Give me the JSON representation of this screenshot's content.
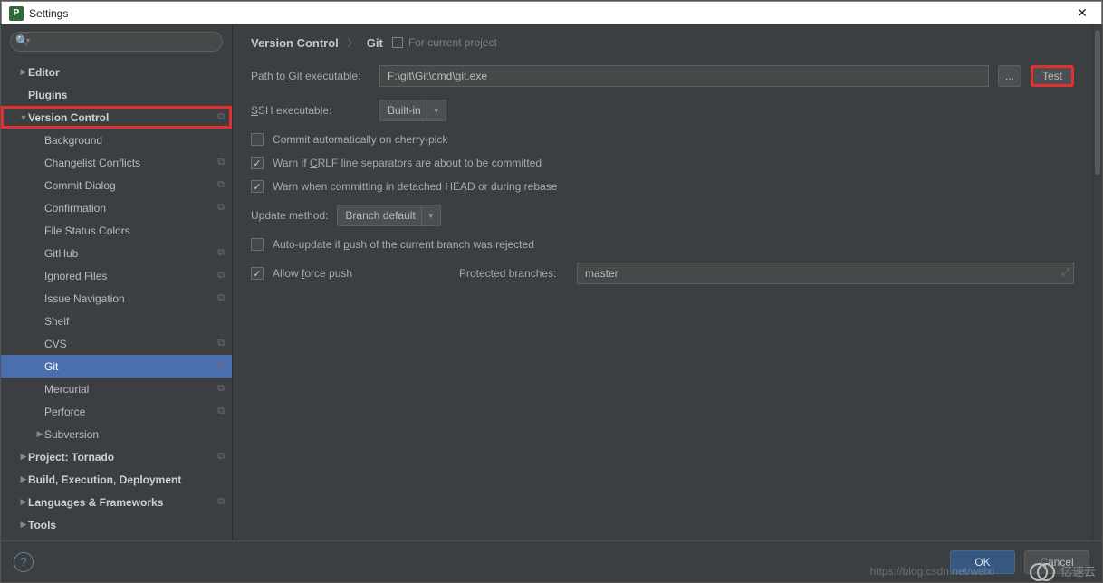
{
  "window": {
    "title": "Settings"
  },
  "search": {
    "placeholder": ""
  },
  "sidebar": {
    "items": [
      {
        "label": "Editor",
        "indent": 0,
        "bold": true,
        "arrow": "▶",
        "micon": false
      },
      {
        "label": "Plugins",
        "indent": 0,
        "bold": true,
        "arrow": "",
        "micon": false
      },
      {
        "label": "Version Control",
        "indent": 0,
        "bold": true,
        "arrow": "▼",
        "micon": true,
        "highlight": true
      },
      {
        "label": "Background",
        "indent": 1,
        "bold": false,
        "arrow": "",
        "micon": false
      },
      {
        "label": "Changelist Conflicts",
        "indent": 1,
        "bold": false,
        "arrow": "",
        "micon": true
      },
      {
        "label": "Commit Dialog",
        "indent": 1,
        "bold": false,
        "arrow": "",
        "micon": true
      },
      {
        "label": "Confirmation",
        "indent": 1,
        "bold": false,
        "arrow": "",
        "micon": true
      },
      {
        "label": "File Status Colors",
        "indent": 1,
        "bold": false,
        "arrow": "",
        "micon": false
      },
      {
        "label": "GitHub",
        "indent": 1,
        "bold": false,
        "arrow": "",
        "micon": true
      },
      {
        "label": "Ignored Files",
        "indent": 1,
        "bold": false,
        "arrow": "",
        "micon": true
      },
      {
        "label": "Issue Navigation",
        "indent": 1,
        "bold": false,
        "arrow": "",
        "micon": true
      },
      {
        "label": "Shelf",
        "indent": 1,
        "bold": false,
        "arrow": "",
        "micon": false
      },
      {
        "label": "CVS",
        "indent": 1,
        "bold": false,
        "arrow": "",
        "micon": true
      },
      {
        "label": "Git",
        "indent": 1,
        "bold": false,
        "arrow": "",
        "micon": true,
        "selected": true
      },
      {
        "label": "Mercurial",
        "indent": 1,
        "bold": false,
        "arrow": "",
        "micon": true
      },
      {
        "label": "Perforce",
        "indent": 1,
        "bold": false,
        "arrow": "",
        "micon": true
      },
      {
        "label": "Subversion",
        "indent": 1,
        "bold": false,
        "arrow": "▶",
        "micon": false
      },
      {
        "label": "Project: Tornado",
        "indent": 0,
        "bold": true,
        "arrow": "▶",
        "micon": true
      },
      {
        "label": "Build, Execution, Deployment",
        "indent": 0,
        "bold": true,
        "arrow": "▶",
        "micon": false
      },
      {
        "label": "Languages & Frameworks",
        "indent": 0,
        "bold": true,
        "arrow": "▶",
        "micon": true
      },
      {
        "label": "Tools",
        "indent": 0,
        "bold": true,
        "arrow": "▶",
        "micon": false
      }
    ]
  },
  "breadcrumb": {
    "a": "Version Control",
    "b": "Git",
    "scope": "For current project"
  },
  "form": {
    "path_label_pre": "Path to ",
    "path_label_u": "G",
    "path_label_post": "it executable:",
    "path_value": "F:\\git\\Git\\cmd\\git.exe",
    "browse": "...",
    "test": "Test",
    "ssh_label_u": "S",
    "ssh_label_post": "SH executable:",
    "ssh_value": "Built-in",
    "chk_cherry": "Commit automatically on cherry-pick",
    "chk_crlf_pre": "Warn if ",
    "chk_crlf_u": "C",
    "chk_crlf_post": "RLF line separators are about to be committed",
    "chk_detached": "Warn when committing in detached HEAD or during rebase",
    "update_label": "Update method:",
    "update_value": "Branch default",
    "chk_autoupd_pre": "Auto-update if ",
    "chk_autoupd_u": "p",
    "chk_autoupd_post": "ush of the current branch was rejected",
    "chk_force_pre": "Allow ",
    "chk_force_u": "f",
    "chk_force_post": "orce push",
    "protected_label": "Protected branches:",
    "protected_value": "master"
  },
  "footer": {
    "ok": "OK",
    "cancel": "Cancel"
  },
  "watermark": "https://blog.csdn.net/weixi",
  "logo_text": "亿速云"
}
